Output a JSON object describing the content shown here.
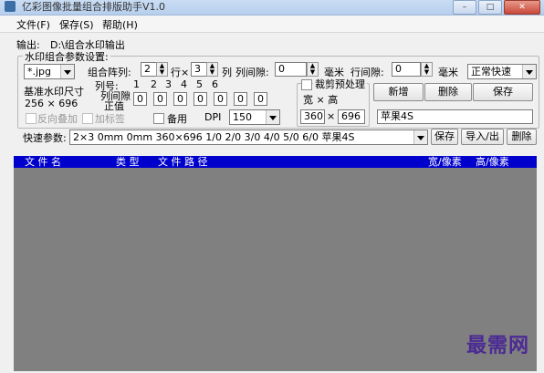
{
  "window": {
    "title": "亿彩图像批量组合排版助手V1.0",
    "buttons": {
      "minimize": "–",
      "maximize": "□",
      "close": "✕"
    }
  },
  "menu": {
    "items": [
      "文件(F)",
      "保存(S)",
      "帮助(H)"
    ]
  },
  "output": {
    "label": "输出:",
    "path": "D:\\组合水印输出"
  },
  "params": {
    "legend": "水印组合参数设置:",
    "format_value": "*.jpg",
    "combo_array_label": "组合阵列:",
    "rows_value": "2",
    "rows_unit": "行×",
    "cols_value": "3",
    "cols_unit": "列",
    "col_gap_label": "列间隙:",
    "col_gap_value": "0",
    "col_gap_unit": "毫米",
    "row_gap_label": "行间隙:",
    "row_gap_value": "0",
    "row_gap_unit": "毫米",
    "speed_value": "正常快速",
    "base_size_label": "基准水印尺寸",
    "base_size_value": "256 × 696",
    "col_no_label": "列号:",
    "col_numbers": [
      "1",
      "2",
      "3",
      "4",
      "5",
      "6"
    ],
    "col_spacing_label_1": "列间隙",
    "col_spacing_label_2": "正值",
    "col_spacing_values": [
      "0",
      "0",
      "0",
      "0",
      "0",
      "0",
      "0"
    ],
    "crop_label": "裁剪预处理",
    "width_height_label": "宽 × 高",
    "crop_w": "360",
    "crop_x": "×",
    "crop_h": "696",
    "reverse_label": "反向叠加",
    "add_tag_label": "加标签",
    "backup_label": "备用",
    "dpi_label": "DPI",
    "dpi_value": "150",
    "new_button": "新增",
    "delete_button": "删除",
    "save_button": "保存",
    "name_value": "苹果4S"
  },
  "quick": {
    "label": "快速参数:",
    "value": "2×3 0mm 0mm 360×696 1/0 2/0 3/0 4/0 5/0 6/0 苹果4S",
    "save_button": "保存",
    "import_export_button": "导入/出",
    "delete_button": "删除"
  },
  "table": {
    "headers": [
      "文 件 名",
      "类 型",
      "文 件 路 径",
      "宽/像素",
      "高/像素"
    ]
  },
  "watermark": "最需网"
}
